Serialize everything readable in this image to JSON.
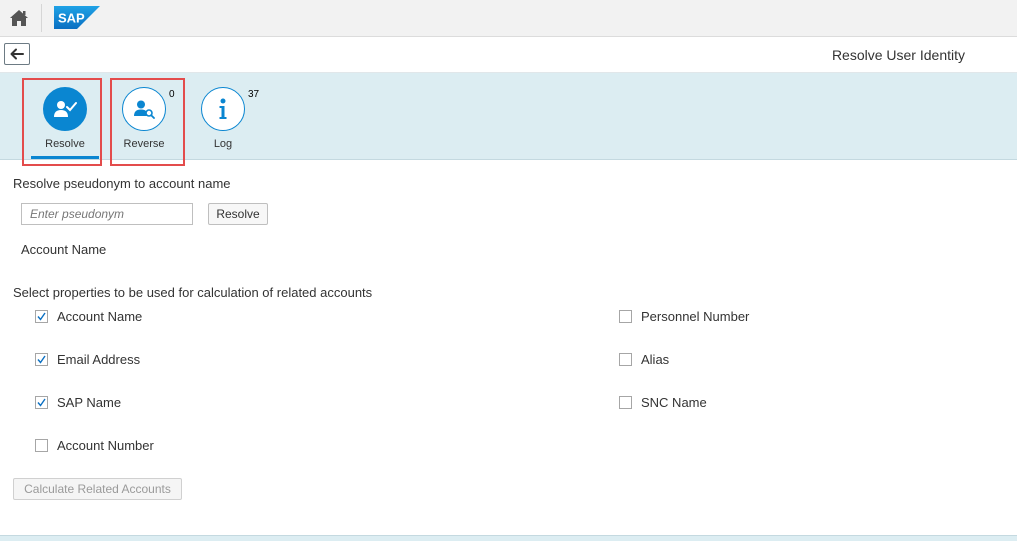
{
  "shell": {
    "home_icon": "home-icon",
    "logo_text": "SAP",
    "logo_color": "#0a86d1"
  },
  "titlebar": {
    "back_icon": "arrow-left-icon",
    "title": "Resolve User Identity"
  },
  "tabs": [
    {
      "label": "Resolve",
      "icon": "user-check-icon",
      "count": "",
      "selected": true
    },
    {
      "label": "Reverse",
      "icon": "user-search-icon",
      "count": "0",
      "selected": false
    },
    {
      "label": "Log",
      "icon": "info-icon",
      "count": "37",
      "selected": false
    }
  ],
  "resolve": {
    "heading": "Resolve pseudonym to account name",
    "input_value": "",
    "input_placeholder": "Enter pseudonym",
    "button_label": "Resolve",
    "result_label": "Account Name"
  },
  "properties": {
    "heading": "Select properties to be used for calculation of related accounts",
    "left": [
      {
        "label": "Account Name",
        "checked": true
      },
      {
        "label": "Email Address",
        "checked": true
      },
      {
        "label": "SAP Name",
        "checked": true
      },
      {
        "label": "Account Number",
        "checked": false
      }
    ],
    "right": [
      {
        "label": "Personnel Number",
        "checked": false
      },
      {
        "label": "Alias",
        "checked": false
      },
      {
        "label": "SNC Name",
        "checked": false
      }
    ]
  },
  "calculate_button": {
    "label": "Calculate Related Accounts",
    "disabled": true
  },
  "colors": {
    "accent": "#0a86d1",
    "tabbar_bg": "#dcedf2",
    "highlight": "#e34c4c"
  }
}
